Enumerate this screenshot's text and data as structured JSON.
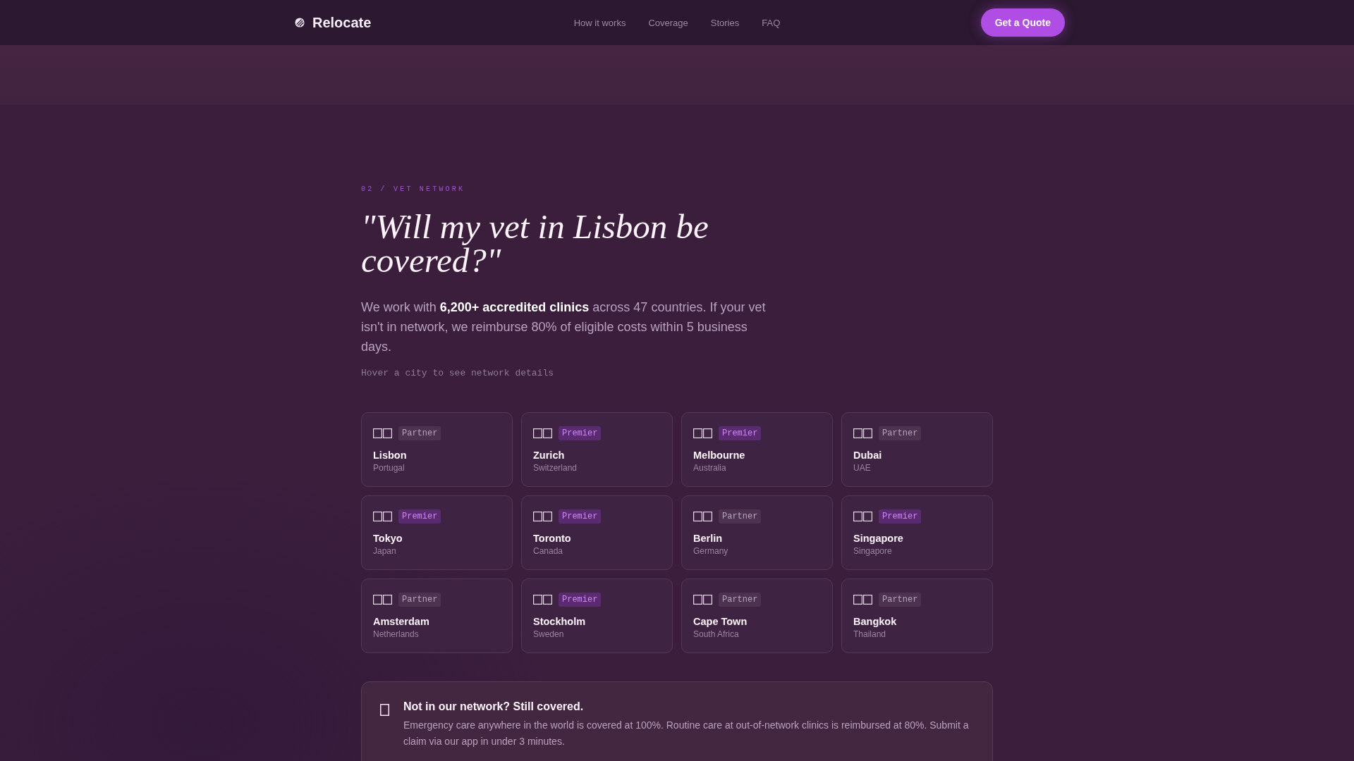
{
  "nav": {
    "brand": "Relocate",
    "links": [
      "How it works",
      "Coverage",
      "Stories",
      "FAQ"
    ],
    "cta": "Get a Quote"
  },
  "section": {
    "eyebrow": "02 / VET NETWORK",
    "heading": "\"Will my vet in Lisbon be covered?\"",
    "intro": "We work with **6,200+ accredited clinics** across 47 countries. If your vet isn't in network, we reimburse 80% of eligible costs within 5 business days.",
    "hint": "Hover a city to see network details"
  },
  "cities": [
    {
      "city": "Lisbon",
      "country": "Portugal",
      "tier": "Partner",
      "kind": "partner"
    },
    {
      "city": "Zurich",
      "country": "Switzerland",
      "tier": "Premier",
      "kind": "premier"
    },
    {
      "city": "Melbourne",
      "country": "Australia",
      "tier": "Premier",
      "kind": "premier"
    },
    {
      "city": "Dubai",
      "country": "UAE",
      "tier": "Partner",
      "kind": "partner"
    },
    {
      "city": "Tokyo",
      "country": "Japan",
      "tier": "Premier",
      "kind": "premier"
    },
    {
      "city": "Toronto",
      "country": "Canada",
      "tier": "Premier",
      "kind": "premier"
    },
    {
      "city": "Berlin",
      "country": "Germany",
      "tier": "Partner",
      "kind": "partner"
    },
    {
      "city": "Singapore",
      "country": "Singapore",
      "tier": "Premier",
      "kind": "premier"
    },
    {
      "city": "Amsterdam",
      "country": "Netherlands",
      "tier": "Partner",
      "kind": "partner"
    },
    {
      "city": "Stockholm",
      "country": "Sweden",
      "tier": "Premier",
      "kind": "premier"
    },
    {
      "city": "Cape Town",
      "country": "South Africa",
      "tier": "Partner",
      "kind": "partner"
    },
    {
      "city": "Bangkok",
      "country": "Thailand",
      "tier": "Partner",
      "kind": "partner"
    }
  ],
  "callout": {
    "title": "Not in our network? Still covered.",
    "body": "Emergency care anywhere in the world is covered at 100%. Routine care at out-of-network clinics is reimbursed at 80%. Submit a claim via our app in under 3 minutes."
  }
}
